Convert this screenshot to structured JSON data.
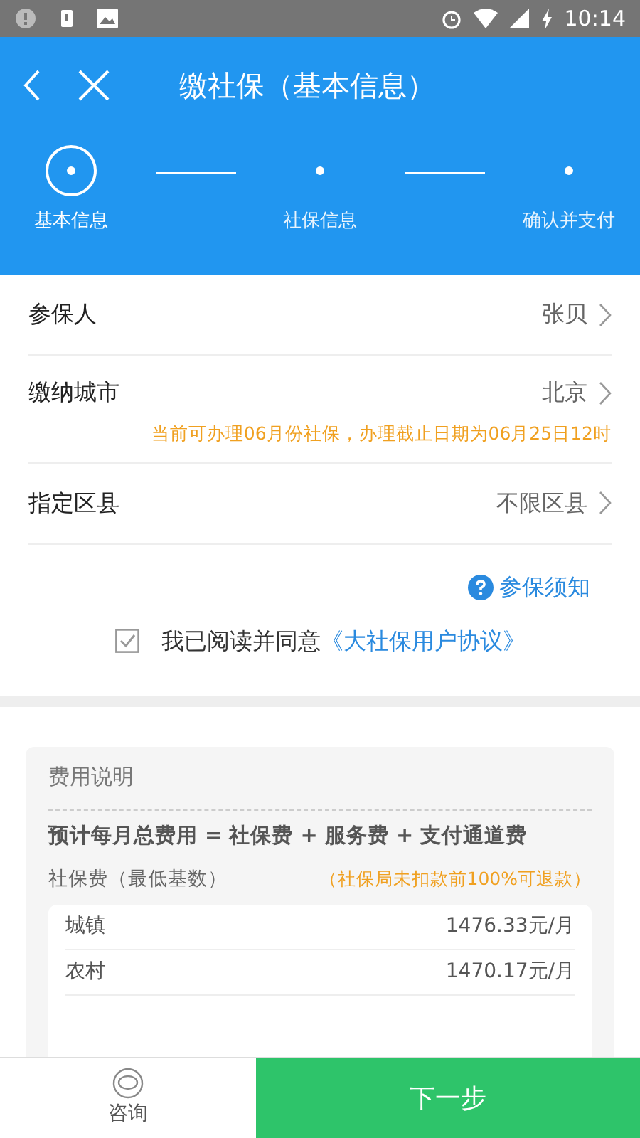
{
  "status_bar": {
    "time": "10:14"
  },
  "header": {
    "title": "缴社保（基本信息）"
  },
  "steps": [
    {
      "label": "基本信息",
      "selected": true
    },
    {
      "label": "社保信息",
      "selected": false
    },
    {
      "label": "确认并支付",
      "selected": false
    }
  ],
  "form": [
    {
      "label": "参保人",
      "value": "张贝"
    },
    {
      "label": "缴纳城市",
      "value": "北京",
      "note": "当前可办理06月份社保，办理截止日期为06月25日12时"
    },
    {
      "label": "指定区县",
      "value": "不限区县"
    }
  ],
  "help_link": "参保须知",
  "agreement": {
    "checked": true,
    "text": "我已阅读并同意",
    "link": "《大社保用户协议》"
  },
  "fees": {
    "title": "费用说明",
    "formula": "预计每月总费用 = 社保费 + 服务费 + 支付通道费",
    "subtitle": "社保费（最低基数）",
    "refund_note": "（社保局未扣款前100%可退款）",
    "rows": [
      {
        "name": "城镇",
        "amount": "1476.33元/月"
      },
      {
        "name": "农村",
        "amount": "1470.17元/月"
      }
    ]
  },
  "bottom_bar": {
    "consult": "咨询",
    "next": "下一步"
  }
}
